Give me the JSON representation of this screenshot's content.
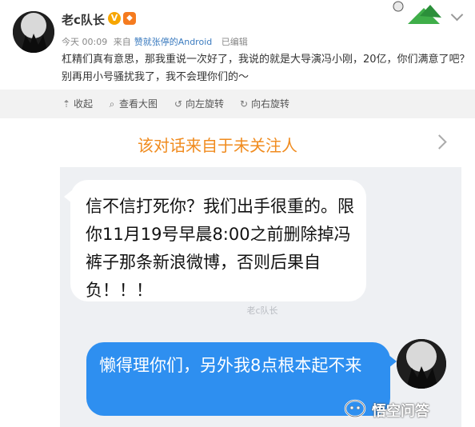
{
  "post": {
    "username": "老c队长",
    "verified_badge": "V",
    "level_badge": "◆",
    "time": "今天 00:09",
    "source_prefix": "来自",
    "source": "赞就张停的Android",
    "edited": "已编辑",
    "text": "杠精们真有意思，那我重说一次好了，我说的就是大导演冯小刚，20亿，你们满意了吧？别再用小号骚扰我了，我不会理你们的～"
  },
  "toolbar": {
    "collapse": "收起",
    "view_large": "查看大图",
    "rotate_left": "向左旋转",
    "rotate_right": "向右旋转"
  },
  "icons": {
    "collapse": "collapse-up-icon",
    "view_large": "magnify-icon",
    "rotate_left": "rotate-left-icon",
    "rotate_right": "rotate-right-icon"
  },
  "chat": {
    "banner": "该对话来自于未关注人",
    "incoming": "信不信打死你？我们出手很重的。限你11月19号早晨8:00之前删除掉冯裤子那条新浪微博，否则后果自负！！！",
    "watermark_mid": "老c队长",
    "outgoing": "懒得理你们，另外我8点根本起不来"
  },
  "footer": {
    "watermark": "悟空问答"
  },
  "colors": {
    "banner_text": "#f08b1e",
    "outgoing_bubble": "#2e8ff0",
    "link": "#3b7bbf",
    "chat_bg": "#eef0f3",
    "toolbar_bg": "#f2f2f2"
  }
}
